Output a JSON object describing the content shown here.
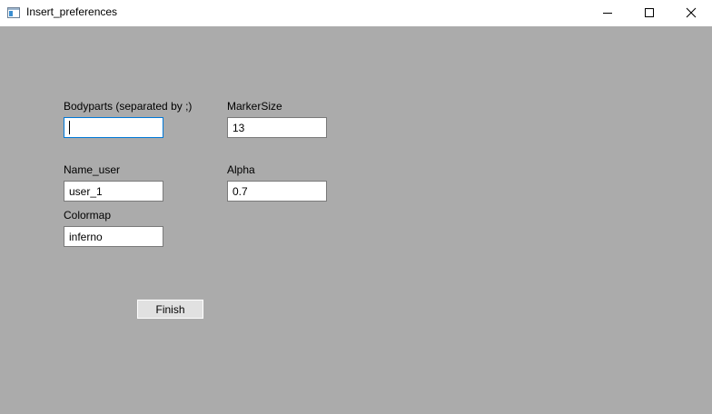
{
  "window": {
    "title": "Insert_preferences",
    "controls": [
      "minimize-icon",
      "maximize-icon",
      "close-icon"
    ]
  },
  "form": {
    "bodyparts": {
      "label": "Bodyparts (separated by ;)",
      "value": ""
    },
    "marker_size": {
      "label": "MarkerSize",
      "value": "13"
    },
    "name_user": {
      "label": "Name_user",
      "value": "user_1"
    },
    "alpha": {
      "label": "Alpha",
      "value": "0.7"
    },
    "colormap": {
      "label": "Colormap",
      "value": "inferno"
    },
    "finish_label": "Finish"
  },
  "colors": {
    "background": "#ababab",
    "focus_border": "#0078d7"
  }
}
